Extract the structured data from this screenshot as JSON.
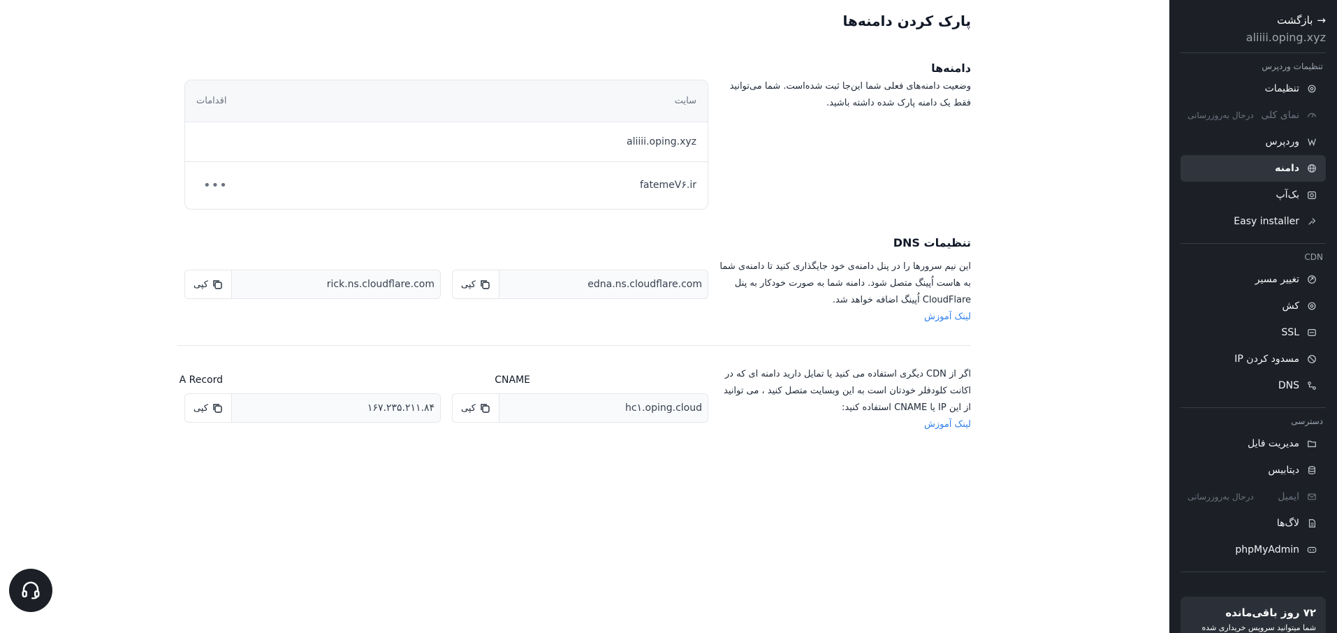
{
  "sidebar": {
    "back_label": "بازگشت",
    "site_domain": "aliiii.oping.xyz",
    "sections": {
      "wordpress": "تنظیمات وردپرس",
      "cdn": "CDN",
      "access": "دسترسی"
    },
    "items": [
      {
        "label": "تنظیمات",
        "icon": "gear-icon"
      },
      {
        "label": "نمای کلی",
        "icon": "gauge-icon",
        "badge": "درحال به‌روزرسانی"
      },
      {
        "label": "وردپرس",
        "icon": "wordpress-icon"
      },
      {
        "label": "دامنه",
        "icon": "globe-icon"
      },
      {
        "label": "بک‌آپ",
        "icon": "backup-icon"
      },
      {
        "label": "Easy installer",
        "icon": "installer-icon"
      },
      {
        "label": "تغییر مسیر",
        "icon": "redirect-icon"
      },
      {
        "label": "کش",
        "icon": "cache-icon"
      },
      {
        "label": "SSL",
        "icon": "ssl-icon"
      },
      {
        "label": "مسدود کردن IP",
        "icon": "block-ip-icon"
      },
      {
        "label": "DNS",
        "icon": "dns-icon"
      },
      {
        "label": "مدیریت فایل",
        "icon": "folder-icon"
      },
      {
        "label": "دیتابیس",
        "icon": "database-icon"
      },
      {
        "label": "ایمیل",
        "icon": "mail-icon",
        "badge": "درحال به‌روزرسانی"
      },
      {
        "label": "لاگ‌ها",
        "icon": "logs-icon"
      },
      {
        "label": "phpMyAdmin",
        "icon": "phpmyadmin-icon"
      }
    ],
    "remaining": {
      "title": "۷۲ روز باقی‌مانده",
      "subtitle": "شما میتوانید سرویس خریداری شده"
    }
  },
  "page": {
    "title": "پارک کردن دامنه‌ها"
  },
  "domains": {
    "title": "دامنه‌ها",
    "description": "وضعیت دامنه‌های فعلی شما این‌جا ثبت شده‌است. شما می‌توانید فقط یک دامنه پارک شده داشته باشید.",
    "table": {
      "col_site": "سایت",
      "col_actions": "اقدامات",
      "rows": [
        {
          "site": "aliiii.oping.xyz"
        },
        {
          "site": "fatemeV۶.ir"
        }
      ]
    }
  },
  "dns": {
    "title": "تنظیمات DNS",
    "description": "این نیم سرورها را در پنل دامنه‌ی خود جایگذاری کنید تا دامنه‌ی شما به هاست اُپینگ متصل شود. دامنه شما به صورت خودکار به پنل CloudFlare اُپینگ اضافه خواهد شد.",
    "link": "لینک آموزش",
    "ns1": "edna.ns.cloudflare.com",
    "ns2": "rick.ns.cloudflare.com",
    "copy_label": "کپی"
  },
  "cdn": {
    "description": "اگر از CDN دیگری استفاده می کنید یا تمایل دارید دامنه ای که در اکانت کلودفلر خودتان است به این وبسایت متصل کنید ، می توانید از این IP یا CNAME استفاده کنید:",
    "link": "لینک آموزش",
    "cname_label": "CNAME",
    "cname_value": "hc۱.oping.cloud",
    "arecord_label": "A Record",
    "arecord_value": "۱۶۷.۲۳۵.۲۱۱.۸۴",
    "copy_label": "کپی"
  },
  "support": {
    "icon": "headset-icon"
  }
}
